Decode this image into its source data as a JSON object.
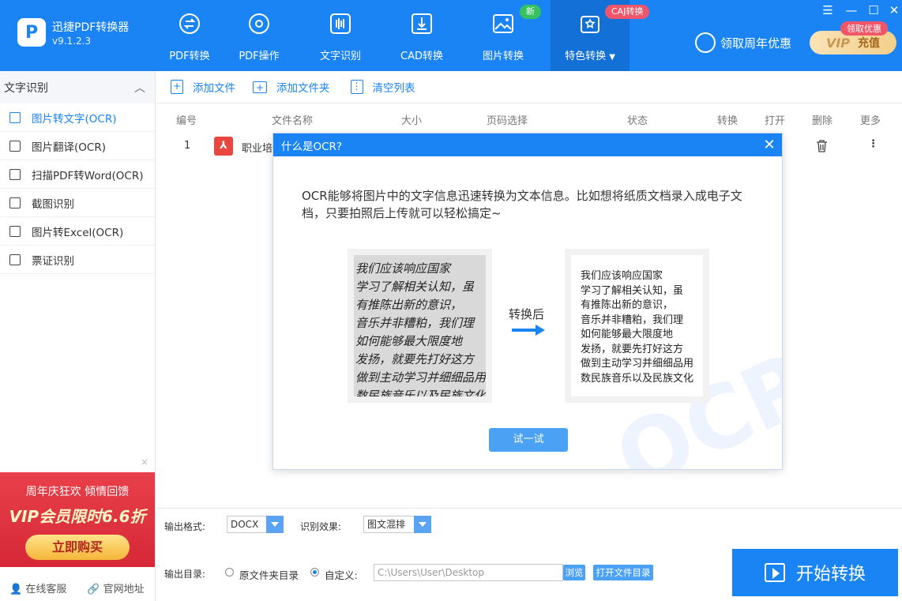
{
  "app": {
    "name": "迅捷PDF转换器",
    "version": "v9.1.2.3",
    "logo_letter": "P"
  },
  "nav": [
    {
      "label": "PDF转换",
      "icon": "pdf-convert-icon"
    },
    {
      "label": "PDF操作",
      "icon": "pdf-operate-icon"
    },
    {
      "label": "文字识别",
      "icon": "text-recognition-icon"
    },
    {
      "label": "CAD转换",
      "icon": "cad-icon"
    },
    {
      "label": "图片转换",
      "icon": "image-icon"
    },
    {
      "label": "特色转换",
      "icon": "special-convert-icon"
    }
  ],
  "badges": {
    "new": "新",
    "caj": "CAJ转换"
  },
  "window_controls": {
    "menu": "☰",
    "minimize": "—",
    "maximize": "☐",
    "close": "✕"
  },
  "promo": {
    "label": "领取周年优惠",
    "vip_text": "VIP",
    "vip_action": "充值",
    "vip_badge": "领取优惠"
  },
  "sidebar": {
    "header": "文字识别",
    "items": [
      {
        "label": "图片转文字(OCR)",
        "icon": "text-box-icon"
      },
      {
        "label": "图片翻译(OCR)",
        "icon": "image-translate-icon"
      },
      {
        "label": "扫描PDF转Word(OCR)",
        "icon": "scan-pdf-icon"
      },
      {
        "label": "截图识别",
        "icon": "screenshot-icon"
      },
      {
        "label": "图片转Excel(OCR)",
        "icon": "excel-icon"
      },
      {
        "label": "票证识别",
        "icon": "ticket-icon"
      }
    ],
    "ad": {
      "line1": "周年庆狂欢 倾情回馈",
      "line2": "VIP会员限时6.6折",
      "button": "立即购买",
      "close": "×"
    },
    "footer": {
      "service": "在线客服",
      "website": "官网地址"
    }
  },
  "toolbar": {
    "add_file": "添加文件",
    "add_folder": "添加文件夹",
    "clear_list": "清空列表"
  },
  "table": {
    "headers": {
      "index": "编号",
      "name": "文件名称",
      "size": "大小",
      "pages": "页码选择",
      "status": "状态",
      "convert": "转换",
      "open": "打开",
      "delete": "删除",
      "more": "更多"
    },
    "rows": [
      {
        "index": "1",
        "name": "职业培",
        "more": "⋮"
      }
    ]
  },
  "modal": {
    "title": "什么是OCR?",
    "close": "✕",
    "description": "OCR能够将图片中的文字信息迅速转换为文本信息。比如想将纸质文档录入成电子文档，只要拍照后上传就可以轻松搞定~",
    "handwriting_lines": [
      "我们应该响应国家",
      "学习了解相关认知，虽",
      "有推陈出新的意识，",
      "音乐并非糟粕，我们理",
      "如何能够最大限度地",
      "发扬，就要先打好这方",
      "做到主动学习并细细品用",
      "数民族音乐以及民族文化"
    ],
    "arrow_label": "转换后",
    "result_lines": [
      "我们应该响应国家",
      "学习了解相关认知，虽",
      "有推陈出新的意识，",
      "音乐并非糟粕，我们理",
      "如何能够最大限度地",
      "发扬，就要先打好这方",
      "做到主动学习并细细品用",
      "数民族音乐以及民族文化"
    ],
    "try_button": "试一试",
    "watermark": "OCR"
  },
  "bottom": {
    "format_label": "输出格式:",
    "format_value": "DOCX",
    "effect_label": "识别效果:",
    "effect_value": "图文混排",
    "dir_label": "输出目录:",
    "option_original": "原文件夹目录",
    "option_custom": "自定义:",
    "path": "C:\\Users\\User\\Desktop",
    "browse": "浏览",
    "open_dir": "打开文件目录",
    "start": "开始转换"
  },
  "colors": {
    "primary": "#1a84f4",
    "active_nav": "#1270d6",
    "pdf_red": "#e8463e",
    "new_green": "#37c261",
    "caj_red": "#f0566a"
  }
}
